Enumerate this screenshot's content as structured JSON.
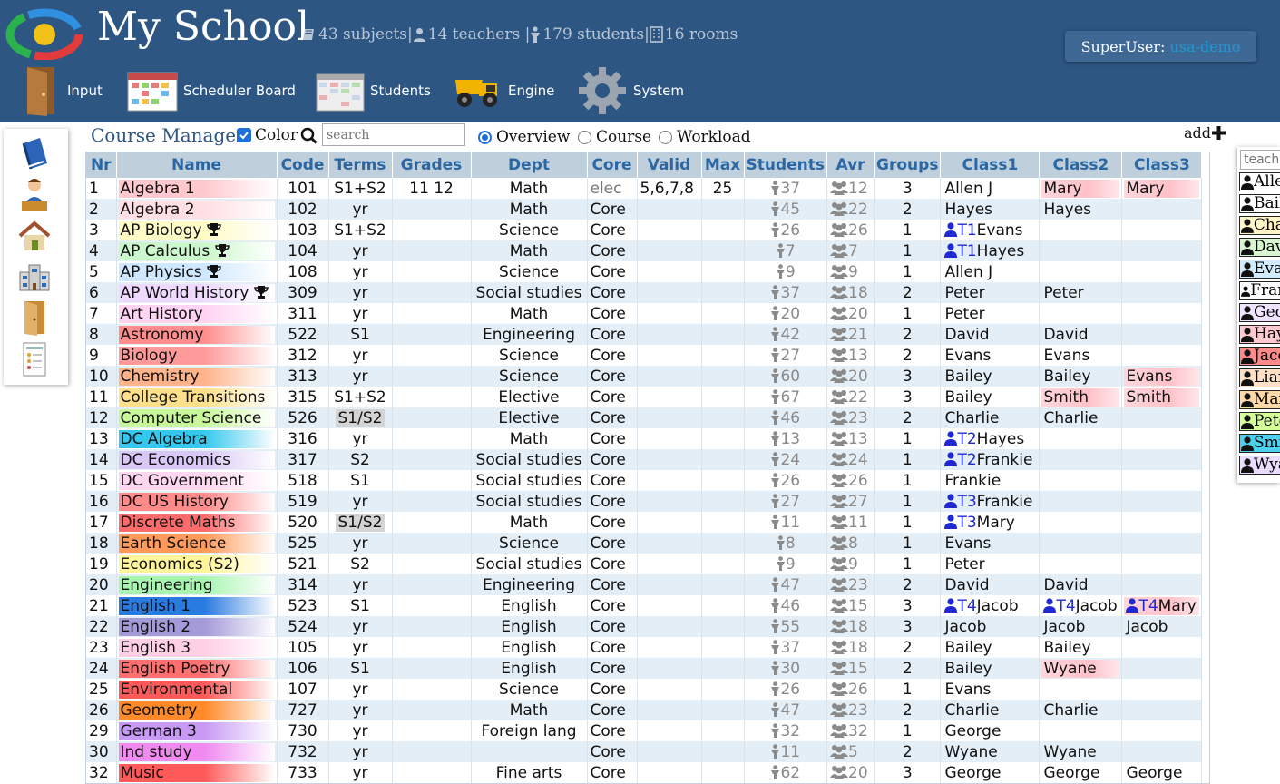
{
  "header": {
    "title": "My School",
    "stats": {
      "subjects": "43 subjects|",
      "teachers": "14 teachers |",
      "students": "179 students|",
      "rooms": "16 rooms"
    },
    "user_label": "SuperUser:",
    "user_account": "usa-demo"
  },
  "nav": [
    {
      "label": "Input",
      "icon": "door-icon"
    },
    {
      "label": "Scheduler Board",
      "icon": "calendar-icon"
    },
    {
      "label": "Students",
      "icon": "schedule-grid-icon"
    },
    {
      "label": "Engine",
      "icon": "dump-truck-icon"
    },
    {
      "label": "System",
      "icon": "gear-icon"
    }
  ],
  "sidebar": [
    "book-icon",
    "teacher-icon",
    "house-icon",
    "school-building-icon",
    "door-icon",
    "report-icon"
  ],
  "toolbar": {
    "title": "Course Manager",
    "color_label": "Color",
    "color_checked": true,
    "search_placeholder": "search",
    "views": [
      {
        "label": "Overview",
        "selected": true
      },
      {
        "label": "Course",
        "selected": false
      },
      {
        "label": "Workload",
        "selected": false
      }
    ],
    "add_label": "add"
  },
  "table": {
    "headers": [
      "Nr",
      "Name",
      "Code",
      "Terms",
      "Grades",
      "Dept",
      "Core",
      "Valid",
      "Max",
      "Students",
      "Avr",
      "Groups",
      "Class1",
      "Class2",
      "Class3"
    ],
    "rows": [
      {
        "nr": "1",
        "name": "Algebra 1",
        "color": "#ffc9cf",
        "code": "101",
        "terms": "S1+S2",
        "grades": "11 12",
        "dept": "Math",
        "core": "elec",
        "valid": "5,6,7,8",
        "max": "25",
        "students": "37",
        "avr": "12",
        "groups": "3",
        "c1": {
          "t": "Allen J"
        },
        "c2": {
          "t": "Mary",
          "hl": true
        },
        "c3": {
          "t": "Mary",
          "hl": true
        }
      },
      {
        "nr": "2",
        "name": "Algebra 2",
        "color": "#ffdfe3",
        "code": "102",
        "terms": "yr",
        "grades": "",
        "dept": "Math",
        "core": "Core",
        "valid": "",
        "max": "",
        "students": "45",
        "avr": "22",
        "groups": "2",
        "c1": {
          "t": "Hayes"
        },
        "c2": {
          "t": "Hayes"
        },
        "c3": {
          "t": ""
        }
      },
      {
        "nr": "3",
        "name": "AP Biology",
        "trophy": true,
        "color": "#fffbc7",
        "code": "103",
        "terms": "S1+S2",
        "grades": "",
        "dept": "Science",
        "core": "Core",
        "valid": "",
        "max": "",
        "students": "26",
        "avr": "26",
        "groups": "1",
        "c1": {
          "t": "Evans",
          "tag": "T1"
        },
        "c2": {
          "t": ""
        },
        "c3": {
          "t": ""
        }
      },
      {
        "nr": "4",
        "name": "AP Calculus",
        "trophy": true,
        "color": "#ccf7cc",
        "code": "104",
        "terms": "yr",
        "grades": "",
        "dept": "Math",
        "core": "Core",
        "valid": "",
        "max": "",
        "students": "7",
        "avr": "7",
        "groups": "1",
        "c1": {
          "t": "Hayes",
          "tag": "T1"
        },
        "c2": {
          "t": ""
        },
        "c3": {
          "t": ""
        }
      },
      {
        "nr": "5",
        "name": "AP Physics",
        "trophy": true,
        "color": "#cfe8ff",
        "code": "108",
        "terms": "yr",
        "grades": "",
        "dept": "Science",
        "core": "Core",
        "valid": "",
        "max": "",
        "students": "9",
        "avr": "9",
        "groups": "1",
        "c1": {
          "t": "Allen J"
        },
        "c2": {
          "t": ""
        },
        "c3": {
          "t": ""
        }
      },
      {
        "nr": "6",
        "name": "AP World History",
        "trophy": true,
        "color": "#efd9ff",
        "code": "309",
        "terms": "yr",
        "grades": "",
        "dept": "Social studies",
        "core": "Core",
        "valid": "",
        "max": "",
        "students": "37",
        "avr": "18",
        "groups": "2",
        "c1": {
          "t": "Peter"
        },
        "c2": {
          "t": "Peter"
        },
        "c3": {
          "t": ""
        }
      },
      {
        "nr": "7",
        "name": "Art History",
        "color": "#ffd3f2",
        "code": "311",
        "terms": "yr",
        "grades": "",
        "dept": "Math",
        "core": "Core",
        "valid": "",
        "max": "",
        "students": "20",
        "avr": "20",
        "groups": "1",
        "c1": {
          "t": "Peter"
        },
        "c2": {
          "t": ""
        },
        "c3": {
          "t": ""
        }
      },
      {
        "nr": "8",
        "name": "Astronomy",
        "color": "#ff8d8d",
        "code": "522",
        "terms": "S1",
        "grades": "",
        "dept": "Engineering",
        "core": "Core",
        "valid": "",
        "max": "",
        "students": "42",
        "avr": "21",
        "groups": "2",
        "c1": {
          "t": "David"
        },
        "c2": {
          "t": "David"
        },
        "c3": {
          "t": ""
        }
      },
      {
        "nr": "9",
        "name": "Biology",
        "color": "#ff9a9a",
        "code": "312",
        "terms": "yr",
        "grades": "",
        "dept": "Science",
        "core": "Core",
        "valid": "",
        "max": "",
        "students": "27",
        "avr": "13",
        "groups": "2",
        "c1": {
          "t": "Evans"
        },
        "c2": {
          "t": "Evans"
        },
        "c3": {
          "t": ""
        }
      },
      {
        "nr": "10",
        "name": "Chemistry",
        "color": "#ffb38a",
        "code": "313",
        "terms": "yr",
        "grades": "",
        "dept": "Science",
        "core": "Core",
        "valid": "",
        "max": "",
        "students": "60",
        "avr": "20",
        "groups": "3",
        "c1": {
          "t": "Bailey"
        },
        "c2": {
          "t": "Bailey"
        },
        "c3": {
          "t": "Evans",
          "hl": true
        }
      },
      {
        "nr": "11",
        "name": "College Transitions",
        "color": "#ffe08a",
        "code": "315",
        "terms": "S1+S2",
        "grades": "",
        "dept": "Elective",
        "core": "Core",
        "valid": "",
        "max": "",
        "students": "67",
        "avr": "22",
        "groups": "3",
        "c1": {
          "t": "Bailey"
        },
        "c2": {
          "t": "Smith",
          "hl": true
        },
        "c3": {
          "t": "Smith",
          "hl": true
        }
      },
      {
        "nr": "12",
        "name": "Computer Science",
        "color": "#c8f79a",
        "code": "526",
        "terms": "S1/S2",
        "terms_box": true,
        "grades": "",
        "dept": "Elective",
        "core": "Core",
        "valid": "",
        "max": "",
        "students": "46",
        "avr": "23",
        "groups": "2",
        "c1": {
          "t": "Charlie"
        },
        "c2": {
          "t": "Charlie"
        },
        "c3": {
          "t": ""
        }
      },
      {
        "nr": "13",
        "name": "DC Algebra",
        "color": "#35c8ee",
        "code": "316",
        "terms": "yr",
        "grades": "",
        "dept": "Math",
        "core": "Core",
        "valid": "",
        "max": "",
        "students": "13",
        "avr": "13",
        "groups": "1",
        "c1": {
          "t": "Hayes",
          "tag": "T2"
        },
        "c2": {
          "t": ""
        },
        "c3": {
          "t": ""
        }
      },
      {
        "nr": "14",
        "name": "DC Economics",
        "color": "#d9c7f5",
        "code": "317",
        "terms": "S2",
        "grades": "",
        "dept": "Social studies",
        "core": "Core",
        "valid": "",
        "max": "",
        "students": "24",
        "avr": "24",
        "groups": "1",
        "c1": {
          "t": "Frankie",
          "tag": "T2"
        },
        "c2": {
          "t": ""
        },
        "c3": {
          "t": ""
        }
      },
      {
        "nr": "15",
        "name": "DC Government",
        "color": "#ffd6ef",
        "code": "518",
        "terms": "S1",
        "grades": "",
        "dept": "Social studies",
        "core": "Core",
        "valid": "",
        "max": "",
        "students": "26",
        "avr": "26",
        "groups": "1",
        "c1": {
          "t": "Frankie"
        },
        "c2": {
          "t": ""
        },
        "c3": {
          "t": ""
        }
      },
      {
        "nr": "16",
        "name": "DC US History",
        "color": "#ff8a8a",
        "code": "519",
        "terms": "yr",
        "grades": "",
        "dept": "Social studies",
        "core": "Core",
        "valid": "",
        "max": "",
        "students": "27",
        "avr": "27",
        "groups": "1",
        "c1": {
          "t": "Frankie",
          "tag": "T3"
        },
        "c2": {
          "t": ""
        },
        "c3": {
          "t": ""
        }
      },
      {
        "nr": "17",
        "name": "Discrete Maths",
        "color": "#ff6a6a",
        "code": "520",
        "terms": "S1/S2",
        "terms_box": true,
        "grades": "",
        "dept": "Math",
        "core": "Core",
        "valid": "",
        "max": "",
        "students": "11",
        "avr": "11",
        "groups": "1",
        "c1": {
          "t": "Mary",
          "tag": "T3"
        },
        "c2": {
          "t": ""
        },
        "c3": {
          "t": ""
        }
      },
      {
        "nr": "18",
        "name": "Earth Science",
        "color": "#ff9a5a",
        "code": "525",
        "terms": "yr",
        "grades": "",
        "dept": "Science",
        "core": "Core",
        "valid": "",
        "max": "",
        "students": "8",
        "avr": "8",
        "groups": "1",
        "c1": {
          "t": "Evans"
        },
        "c2": {
          "t": ""
        },
        "c3": {
          "t": ""
        }
      },
      {
        "nr": "19",
        "name": "Economics (S2)",
        "color": "#fff59a",
        "code": "521",
        "terms": "S2",
        "grades": "",
        "dept": "Social studies",
        "core": "Core",
        "valid": "",
        "max": "",
        "students": "9",
        "avr": "9",
        "groups": "1",
        "c1": {
          "t": "Peter"
        },
        "c2": {
          "t": ""
        },
        "c3": {
          "t": ""
        }
      },
      {
        "nr": "20",
        "name": "Engineering",
        "color": "#a8f5b0",
        "code": "314",
        "terms": "yr",
        "grades": "",
        "dept": "Engineering",
        "core": "Core",
        "valid": "",
        "max": "",
        "students": "47",
        "avr": "23",
        "groups": "2",
        "c1": {
          "t": "David"
        },
        "c2": {
          "t": "David"
        },
        "c3": {
          "t": ""
        }
      },
      {
        "nr": "21",
        "name": "English 1",
        "color": "#2a7be0",
        "code": "523",
        "terms": "S1",
        "grades": "",
        "dept": "English",
        "core": "Core",
        "valid": "",
        "max": "",
        "students": "46",
        "avr": "15",
        "groups": "3",
        "c1": {
          "t": "Jacob",
          "tag": "T4"
        },
        "c2": {
          "t": "Jacob",
          "tag": "T4"
        },
        "c3": {
          "t": "Mary",
          "tag": "T4",
          "hl": true
        }
      },
      {
        "nr": "22",
        "name": "English 2",
        "color": "#a59bd8",
        "code": "524",
        "terms": "yr",
        "grades": "",
        "dept": "English",
        "core": "Core",
        "valid": "",
        "max": "",
        "students": "55",
        "avr": "18",
        "groups": "3",
        "c1": {
          "t": "Jacob"
        },
        "c2": {
          "t": "Jacob"
        },
        "c3": {
          "t": "Jacob"
        }
      },
      {
        "nr": "23",
        "name": "English 3",
        "color": "#ffcfe6",
        "code": "105",
        "terms": "yr",
        "grades": "",
        "dept": "English",
        "core": "Core",
        "valid": "",
        "max": "",
        "students": "37",
        "avr": "18",
        "groups": "2",
        "c1": {
          "t": "Bailey"
        },
        "c2": {
          "t": "Bailey"
        },
        "c3": {
          "t": ""
        }
      },
      {
        "nr": "24",
        "name": "English Poetry",
        "color": "#ff6f6f",
        "code": "106",
        "terms": "S1",
        "grades": "",
        "dept": "English",
        "core": "Core",
        "valid": "",
        "max": "",
        "students": "30",
        "avr": "15",
        "groups": "2",
        "c1": {
          "t": "Bailey"
        },
        "c2": {
          "t": "Wyane",
          "hl": true
        },
        "c3": {
          "t": ""
        }
      },
      {
        "nr": "25",
        "name": "Environmental",
        "color": "#ff5a5a",
        "code": "107",
        "terms": "yr",
        "grades": "",
        "dept": "Science",
        "core": "Core",
        "valid": "",
        "max": "",
        "students": "26",
        "avr": "26",
        "groups": "1",
        "c1": {
          "t": "Evans"
        },
        "c2": {
          "t": ""
        },
        "c3": {
          "t": ""
        }
      },
      {
        "nr": "26",
        "name": "Geometry",
        "color": "#ff8a2a",
        "code": "727",
        "terms": "yr",
        "grades": "",
        "dept": "Math",
        "core": "Core",
        "valid": "",
        "max": "",
        "students": "47",
        "avr": "23",
        "groups": "2",
        "c1": {
          "t": "Charlie"
        },
        "c2": {
          "t": "Charlie"
        },
        "c3": {
          "t": ""
        }
      },
      {
        "nr": "29",
        "name": "German 3",
        "color": "#c89af5",
        "code": "730",
        "terms": "yr",
        "grades": "",
        "dept": "Foreign lang",
        "core": "Core",
        "valid": "",
        "max": "",
        "students": "32",
        "avr": "32",
        "groups": "1",
        "c1": {
          "t": "George"
        },
        "c2": {
          "t": ""
        },
        "c3": {
          "t": ""
        }
      },
      {
        "nr": "30",
        "name": "Ind study",
        "color": "#f08af0",
        "code": "732",
        "terms": "yr",
        "grades": "",
        "dept": "",
        "core": "Core",
        "valid": "",
        "max": "",
        "students": "11",
        "avr": "5",
        "groups": "2",
        "c1": {
          "t": "Wyane"
        },
        "c2": {
          "t": "Wyane"
        },
        "c3": {
          "t": ""
        }
      },
      {
        "nr": "32",
        "name": "Music",
        "color": "#ff5a5a",
        "code": "733",
        "terms": "yr",
        "grades": "",
        "dept": "Fine arts",
        "core": "Core",
        "valid": "",
        "max": "",
        "students": "62",
        "avr": "20",
        "groups": "3",
        "c1": {
          "t": "George"
        },
        "c2": {
          "t": "George"
        },
        "c3": {
          "t": "George"
        }
      }
    ]
  },
  "teachers_panel": {
    "search_placeholder": "teacher",
    "teachers": [
      {
        "name": "Allen",
        "color": "#ffffff"
      },
      {
        "name": "Bailey",
        "color": "#ffffff"
      },
      {
        "name": "Charlie",
        "color": "#fff6c7"
      },
      {
        "name": "David",
        "color": "#d9f5d0"
      },
      {
        "name": "Evans",
        "color": "#d2ecff"
      },
      {
        "name": "Frankie",
        "color": "#ffffff"
      },
      {
        "name": "George",
        "color": "#efe3ff"
      },
      {
        "name": "Hayes",
        "color": "#ffc9cf"
      },
      {
        "name": "Jacob",
        "color": "#ff8a8a"
      },
      {
        "name": "Liam",
        "color": "#ffe0c4"
      },
      {
        "name": "Mary",
        "color": "#ffd8a8"
      },
      {
        "name": "Peter",
        "color": "#d6ff9a"
      },
      {
        "name": "Smith",
        "color": "#4bd0ee"
      },
      {
        "name": "Wyane",
        "color": "#e9dcff"
      }
    ]
  },
  "colors": {
    "header_bg": "#2d5683",
    "accent_blue": "#1f6fd6",
    "table_header": "#bfcfdc",
    "row_alt": "#e3eef6",
    "highlight": "#ffc9cf"
  }
}
